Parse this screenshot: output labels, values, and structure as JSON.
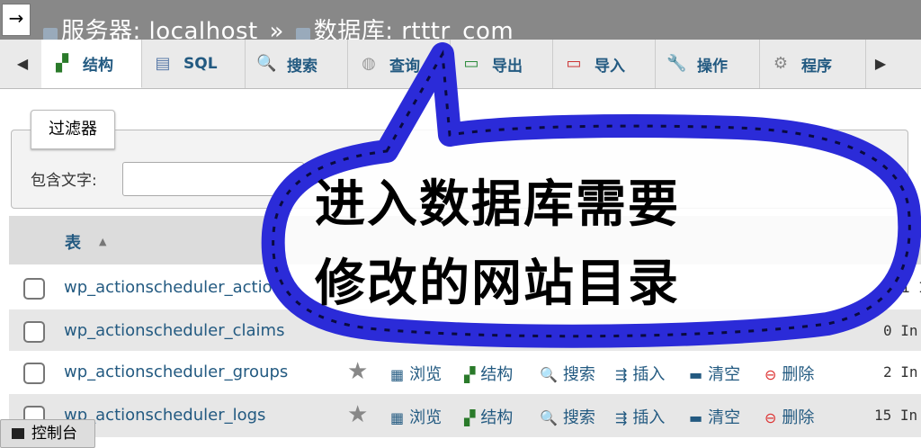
{
  "nav": {
    "back_arrow": "→"
  },
  "breadcrumb": {
    "server_label": "服务器: localhost",
    "separator": "»",
    "db_label": "数据库: rtttr_com"
  },
  "tabs": [
    {
      "label": "结构",
      "icon": "structure-icon"
    },
    {
      "label": "SQL",
      "icon": "sql-icon"
    },
    {
      "label": "搜索",
      "icon": "search-icon"
    },
    {
      "label": "查询",
      "icon": "query-icon"
    },
    {
      "label": "导出",
      "icon": "export-icon"
    },
    {
      "label": "导入",
      "icon": "import-icon"
    },
    {
      "label": "操作",
      "icon": "wrench-icon"
    },
    {
      "label": "程序",
      "icon": "routines-icon"
    }
  ],
  "filter": {
    "tab_label": "过滤器",
    "contains_label": "包含文字:",
    "value": ""
  },
  "table_header": {
    "table": "表"
  },
  "actions": {
    "browse": "浏览",
    "structure": "结构",
    "search": "搜索",
    "insert": "插入",
    "empty": "清空",
    "drop": "删除"
  },
  "rows": [
    {
      "name": "wp_actionscheduler_actions",
      "count": "1 In"
    },
    {
      "name": "wp_actionscheduler_claims",
      "count": "0 In"
    },
    {
      "name": "wp_actionscheduler_groups",
      "count": "2 In"
    },
    {
      "name": "wp_actionscheduler_logs",
      "count": "15 In"
    }
  ],
  "console": {
    "label": "控制台"
  },
  "overlay": {
    "line1": "进入数据库需要",
    "line2": "修改的网站目录"
  }
}
